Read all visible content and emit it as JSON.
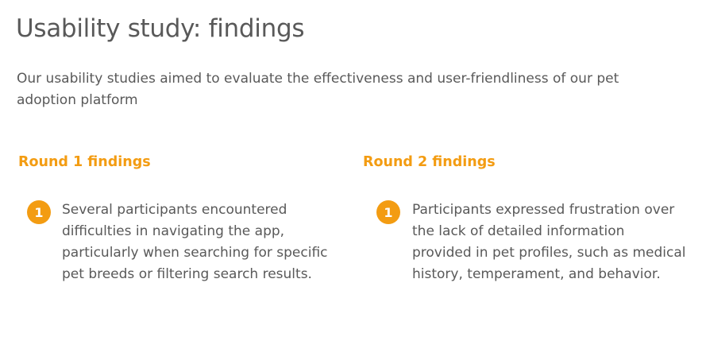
{
  "title": "Usability study: findings",
  "intro": "Our usability studies aimed to evaluate the effectiveness and user-friendliness of our pet adoption platform",
  "rounds": [
    {
      "heading": "Round 1 findings",
      "findings": [
        {
          "number": "1",
          "text": "Several participants encountered difficulties in navigating the app, particularly when searching for specific pet breeds or filtering search results."
        }
      ]
    },
    {
      "heading": "Round 2 findings",
      "findings": [
        {
          "number": "1",
          "text": " Participants expressed frustration over the lack of detailed information provided in pet profiles, such as medical history, temperament, and behavior."
        }
      ]
    }
  ],
  "colors": {
    "accent": "#f39c12",
    "text": "#595959",
    "background": "#ffffff"
  }
}
